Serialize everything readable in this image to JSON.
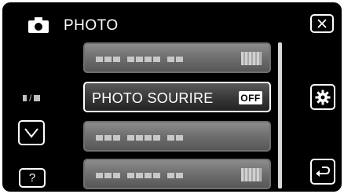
{
  "header": {
    "icon": "camera-icon",
    "title": "PHOTO"
  },
  "controls": {
    "close_icon": "close-icon",
    "down_icon": "chevron-down-icon",
    "help_label": "?",
    "settings_icon": "gear-icon",
    "back_icon": "return-arrow-icon",
    "mode_icon": "mode-toggle-icon"
  },
  "menu": {
    "items": [
      {
        "label": "",
        "state": "disabled",
        "icon": "setting-value-icon"
      },
      {
        "label": "PHOTO SOURIRE",
        "value": "OFF",
        "state": "selected"
      },
      {
        "label": "",
        "state": "disabled"
      },
      {
        "label": "",
        "state": "disabled",
        "icon": "setting-value-icon"
      }
    ]
  },
  "colors": {
    "background": "#000000",
    "text": "#ffffff",
    "item": "#707070",
    "selected_border": "#ffffff"
  }
}
